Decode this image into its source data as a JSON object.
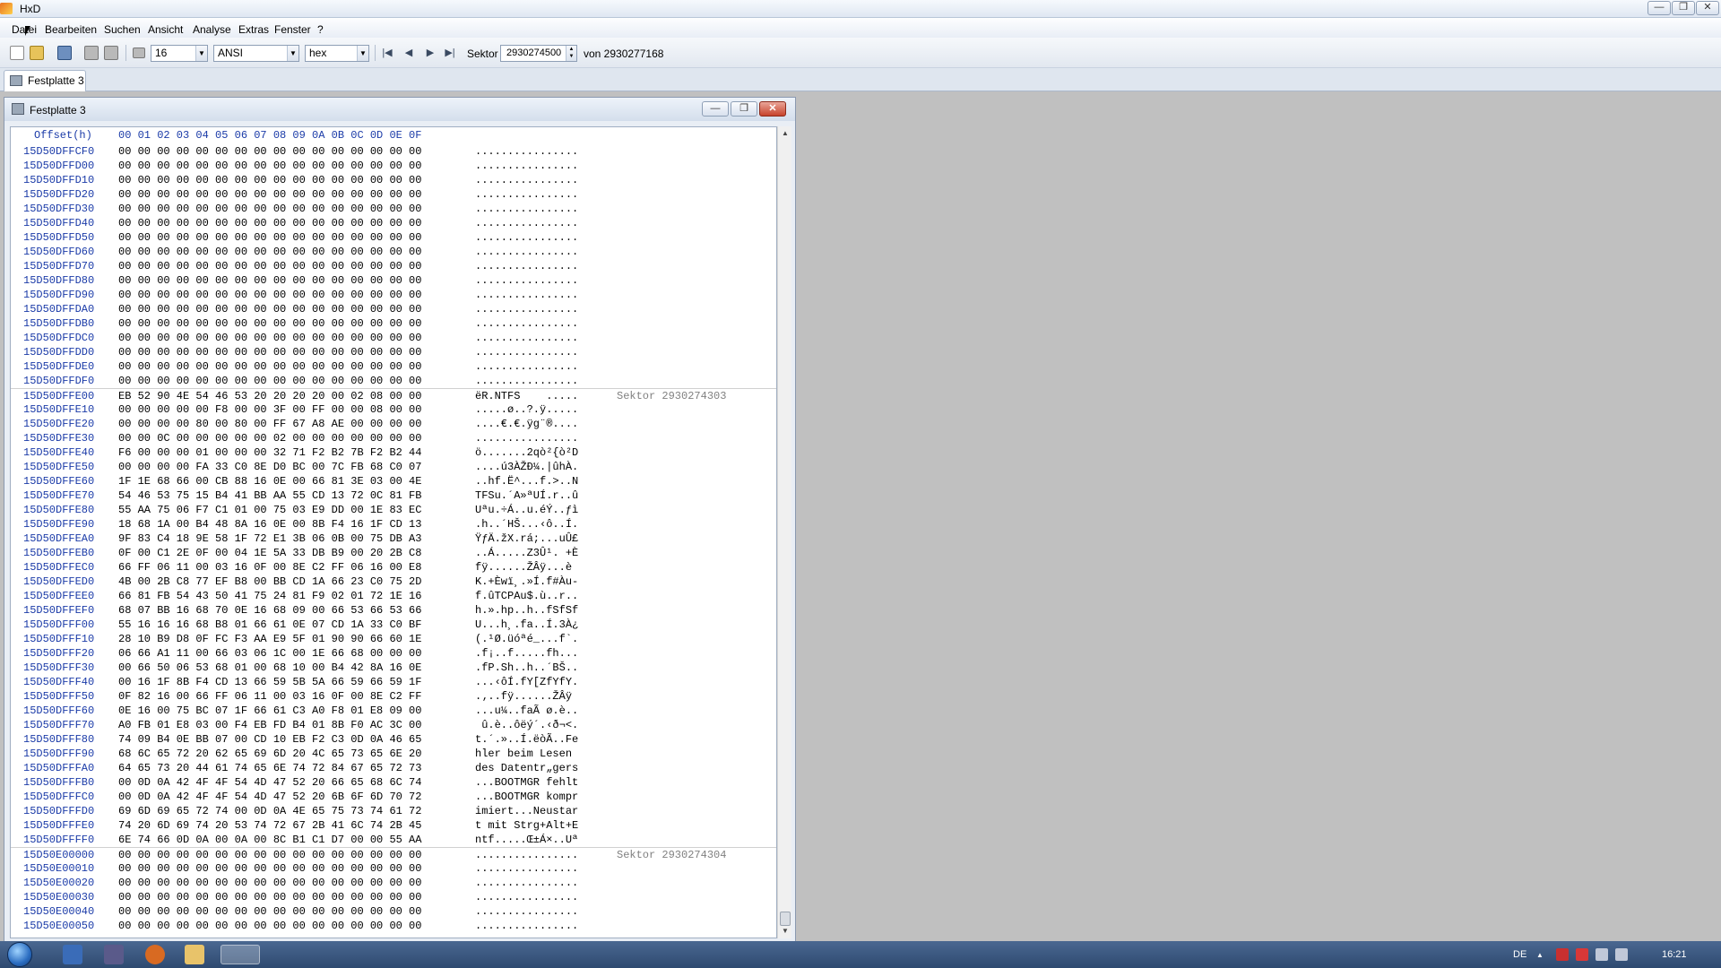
{
  "window": {
    "title": "HxD",
    "min_label": "—",
    "max_label": "❐",
    "close_label": "✕"
  },
  "menu": [
    "Datei",
    "Bearbeiten",
    "Suchen",
    "Ansicht",
    "Analyse",
    "Extras",
    "Fenster",
    "?"
  ],
  "toolbar": {
    "bytes_per_row": "16",
    "charset": "ANSI",
    "offset_base": "hex",
    "sector_label": "Sektor",
    "sector_value": "2930274500",
    "sector_total": "von 2930277168",
    "nav_first": "|◀",
    "nav_prev": "◀",
    "nav_next": "▶",
    "nav_last": "▶|",
    "combo_arrow": "▼",
    "spin_up": "▲",
    "spin_down": "▼"
  },
  "tab": {
    "label": "Festplatte 3"
  },
  "child": {
    "title": "Festplatte 3",
    "min_label": "—",
    "max_label": "❐",
    "close_label": "✕"
  },
  "hex": {
    "offset_header": "Offset(h)",
    "column_header": "00 01 02 03 04 05 06 07 08 09 0A 0B 0C 0D 0E 0F",
    "rows": [
      {
        "addr": "15D50DFFCF0",
        "hex": "00 00 00 00 00 00 00 00 00 00 00 00 00 00 00 00",
        "text": "................",
        "sec": ""
      },
      {
        "addr": "15D50DFFD00",
        "hex": "00 00 00 00 00 00 00 00 00 00 00 00 00 00 00 00",
        "text": "................",
        "sec": ""
      },
      {
        "addr": "15D50DFFD10",
        "hex": "00 00 00 00 00 00 00 00 00 00 00 00 00 00 00 00",
        "text": "................",
        "sec": ""
      },
      {
        "addr": "15D50DFFD20",
        "hex": "00 00 00 00 00 00 00 00 00 00 00 00 00 00 00 00",
        "text": "................",
        "sec": ""
      },
      {
        "addr": "15D50DFFD30",
        "hex": "00 00 00 00 00 00 00 00 00 00 00 00 00 00 00 00",
        "text": "................",
        "sec": ""
      },
      {
        "addr": "15D50DFFD40",
        "hex": "00 00 00 00 00 00 00 00 00 00 00 00 00 00 00 00",
        "text": "................",
        "sec": ""
      },
      {
        "addr": "15D50DFFD50",
        "hex": "00 00 00 00 00 00 00 00 00 00 00 00 00 00 00 00",
        "text": "................",
        "sec": ""
      },
      {
        "addr": "15D50DFFD60",
        "hex": "00 00 00 00 00 00 00 00 00 00 00 00 00 00 00 00",
        "text": "................",
        "sec": ""
      },
      {
        "addr": "15D50DFFD70",
        "hex": "00 00 00 00 00 00 00 00 00 00 00 00 00 00 00 00",
        "text": "................",
        "sec": ""
      },
      {
        "addr": "15D50DFFD80",
        "hex": "00 00 00 00 00 00 00 00 00 00 00 00 00 00 00 00",
        "text": "................",
        "sec": ""
      },
      {
        "addr": "15D50DFFD90",
        "hex": "00 00 00 00 00 00 00 00 00 00 00 00 00 00 00 00",
        "text": "................",
        "sec": ""
      },
      {
        "addr": "15D50DFFDA0",
        "hex": "00 00 00 00 00 00 00 00 00 00 00 00 00 00 00 00",
        "text": "................",
        "sec": ""
      },
      {
        "addr": "15D50DFFDB0",
        "hex": "00 00 00 00 00 00 00 00 00 00 00 00 00 00 00 00",
        "text": "................",
        "sec": ""
      },
      {
        "addr": "15D50DFFDC0",
        "hex": "00 00 00 00 00 00 00 00 00 00 00 00 00 00 00 00",
        "text": "................",
        "sec": ""
      },
      {
        "addr": "15D50DFFDD0",
        "hex": "00 00 00 00 00 00 00 00 00 00 00 00 00 00 00 00",
        "text": "................",
        "sec": ""
      },
      {
        "addr": "15D50DFFDE0",
        "hex": "00 00 00 00 00 00 00 00 00 00 00 00 00 00 00 00",
        "text": "................",
        "sec": ""
      },
      {
        "addr": "15D50DFFDF0",
        "hex": "00 00 00 00 00 00 00 00 00 00 00 00 00 00 00 00",
        "text": "................",
        "sec": ""
      },
      {
        "addr": "15D50DFFE00",
        "hex": "EB 52 90 4E 54 46 53 20 20 20 20 00 02 08 00 00",
        "text": "ëR.NTFS    .....",
        "sec": "Sektor 2930274303"
      },
      {
        "addr": "15D50DFFE10",
        "hex": "00 00 00 00 00 F8 00 00 3F 00 FF 00 00 08 00 00",
        "text": ".....ø..?.ÿ.....",
        "sec": ""
      },
      {
        "addr": "15D50DFFE20",
        "hex": "00 00 00 00 80 00 80 00 FF 67 A8 AE 00 00 00 00",
        "text": "....€.€.ÿg¨®....",
        "sec": ""
      },
      {
        "addr": "15D50DFFE30",
        "hex": "00 00 0C 00 00 00 00 00 02 00 00 00 00 00 00 00",
        "text": "................",
        "sec": ""
      },
      {
        "addr": "15D50DFFE40",
        "hex": "F6 00 00 00 01 00 00 00 32 71 F2 B2 7B F2 B2 44",
        "text": "ö.......2qò²{ò²D",
        "sec": ""
      },
      {
        "addr": "15D50DFFE50",
        "hex": "00 00 00 00 FA 33 C0 8E D0 BC 00 7C FB 68 C0 07",
        "text": "....ú3ÀŽÐ¼.|ûhÀ.",
        "sec": ""
      },
      {
        "addr": "15D50DFFE60",
        "hex": "1F 1E 68 66 00 CB 88 16 0E 00 66 81 3E 03 00 4E",
        "text": "..hf.Ë^...f.>..N",
        "sec": ""
      },
      {
        "addr": "15D50DFFE70",
        "hex": "54 46 53 75 15 B4 41 BB AA 55 CD 13 72 0C 81 FB",
        "text": "TFSu.´A»ªUÍ.r..û",
        "sec": ""
      },
      {
        "addr": "15D50DFFE80",
        "hex": "55 AA 75 06 F7 C1 01 00 75 03 E9 DD 00 1E 83 EC",
        "text": "Uªu.÷Á..u.éÝ..ƒì",
        "sec": ""
      },
      {
        "addr": "15D50DFFE90",
        "hex": "18 68 1A 00 B4 48 8A 16 0E 00 8B F4 16 1F CD 13",
        "text": ".h..´HŠ...‹ô..Í.",
        "sec": ""
      },
      {
        "addr": "15D50DFFEA0",
        "hex": "9F 83 C4 18 9E 58 1F 72 E1 3B 06 0B 00 75 DB A3",
        "text": "ŸƒÄ.žX.rá;...uÛ£",
        "sec": ""
      },
      {
        "addr": "15D50DFFEB0",
        "hex": "0F 00 C1 2E 0F 00 04 1E 5A 33 DB B9 00 20 2B C8",
        "text": "..Á.....Z3Û¹. +È",
        "sec": ""
      },
      {
        "addr": "15D50DFFEC0",
        "hex": "66 FF 06 11 00 03 16 0F 00 8E C2 FF 06 16 00 E8",
        "text": "fÿ......ŽÂÿ...è",
        "sec": ""
      },
      {
        "addr": "15D50DFFED0",
        "hex": "4B 00 2B C8 77 EF B8 00 BB CD 1A 66 23 C0 75 2D",
        "text": "K.+Èwï¸.»Í.f#Àu-",
        "sec": ""
      },
      {
        "addr": "15D50DFFEE0",
        "hex": "66 81 FB 54 43 50 41 75 24 81 F9 02 01 72 1E 16",
        "text": "f.ûTCPAu$.ù..r..",
        "sec": ""
      },
      {
        "addr": "15D50DFFEF0",
        "hex": "68 07 BB 16 68 70 0E 16 68 09 00 66 53 66 53 66",
        "text": "h.».hp..h..fSfSf",
        "sec": ""
      },
      {
        "addr": "15D50DFFF00",
        "hex": "55 16 16 16 68 B8 01 66 61 0E 07 CD 1A 33 C0 BF",
        "text": "U...h¸.fa..Í.3À¿",
        "sec": ""
      },
      {
        "addr": "15D50DFFF10",
        "hex": "28 10 B9 D8 0F FC F3 AA E9 5F 01 90 90 66 60 1E",
        "text": "(.¹Ø.üóªé_...f`.",
        "sec": ""
      },
      {
        "addr": "15D50DFFF20",
        "hex": "06 66 A1 11 00 66 03 06 1C 00 1E 66 68 00 00 00",
        "text": ".f¡..f.....fh...",
        "sec": ""
      },
      {
        "addr": "15D50DFFF30",
        "hex": "00 66 50 06 53 68 01 00 68 10 00 B4 42 8A 16 0E",
        "text": ".fP.Sh..h..´BŠ..",
        "sec": ""
      },
      {
        "addr": "15D50DFFF40",
        "hex": "00 16 1F 8B F4 CD 13 66 59 5B 5A 66 59 66 59 1F",
        "text": "...‹ôÍ.fY[ZfYfY.",
        "sec": ""
      },
      {
        "addr": "15D50DFFF50",
        "hex": "0F 82 16 00 66 FF 06 11 00 03 16 0F 00 8E C2 FF",
        "text": ".‚..fÿ......ŽÂÿ",
        "sec": ""
      },
      {
        "addr": "15D50DFFF60",
        "hex": "0E 16 00 75 BC 07 1F 66 61 C3 A0 F8 01 E8 09 00",
        "text": "...u¼..faÃ ø.è..",
        "sec": ""
      },
      {
        "addr": "15D50DFFF70",
        "hex": "A0 FB 01 E8 03 00 F4 EB FD B4 01 8B F0 AC 3C 00",
        "text": " û.è..ôëý´.‹ð¬<.",
        "sec": ""
      },
      {
        "addr": "15D50DFFF80",
        "hex": "74 09 B4 0E BB 07 00 CD 10 EB F2 C3 0D 0A 46 65",
        "text": "t.´.»..Í.ëòÃ..Fe",
        "sec": ""
      },
      {
        "addr": "15D50DFFF90",
        "hex": "68 6C 65 72 20 62 65 69 6D 20 4C 65 73 65 6E 20",
        "text": "hler beim Lesen ",
        "sec": ""
      },
      {
        "addr": "15D50DFFFA0",
        "hex": "64 65 73 20 44 61 74 65 6E 74 72 84 67 65 72 73",
        "text": "des Datentr„gers",
        "sec": ""
      },
      {
        "addr": "15D50DFFFB0",
        "hex": "00 0D 0A 42 4F 4F 54 4D 47 52 20 66 65 68 6C 74",
        "text": "...BOOTMGR fehlt",
        "sec": ""
      },
      {
        "addr": "15D50DFFFC0",
        "hex": "00 0D 0A 42 4F 4F 54 4D 47 52 20 6B 6F 6D 70 72",
        "text": "...BOOTMGR kompr",
        "sec": ""
      },
      {
        "addr": "15D50DFFFD0",
        "hex": "69 6D 69 65 72 74 00 0D 0A 4E 65 75 73 74 61 72",
        "text": "imiert...Neustar",
        "sec": ""
      },
      {
        "addr": "15D50DFFFE0",
        "hex": "74 20 6D 69 74 20 53 74 72 67 2B 41 6C 74 2B 45",
        "text": "t mit Strg+Alt+E",
        "sec": ""
      },
      {
        "addr": "15D50DFFFF0",
        "hex": "6E 74 66 0D 0A 00 0A 00 8C B1 C1 D7 00 00 55 AA",
        "text": "ntf.....Œ±Á×..Uª",
        "sec": ""
      },
      {
        "addr": "15D50E00000",
        "hex": "00 00 00 00 00 00 00 00 00 00 00 00 00 00 00 00",
        "text": "................",
        "sec": "Sektor 2930274304"
      },
      {
        "addr": "15D50E00010",
        "hex": "00 00 00 00 00 00 00 00 00 00 00 00 00 00 00 00",
        "text": "................",
        "sec": ""
      },
      {
        "addr": "15D50E00020",
        "hex": "00 00 00 00 00 00 00 00 00 00 00 00 00 00 00 00",
        "text": "................",
        "sec": ""
      },
      {
        "addr": "15D50E00030",
        "hex": "00 00 00 00 00 00 00 00 00 00 00 00 00 00 00 00",
        "text": "................",
        "sec": ""
      },
      {
        "addr": "15D50E00040",
        "hex": "00 00 00 00 00 00 00 00 00 00 00 00 00 00 00 00",
        "text": "................",
        "sec": ""
      },
      {
        "addr": "15D50E00050",
        "hex": "00 00 00 00 00 00 00 00 00 00 00 00 00 00 00 00",
        "text": "................",
        "sec": ""
      }
    ]
  },
  "scrollbar": {
    "up_label": "▲",
    "down_label": "▼"
  },
  "taskbar": {
    "lang": "DE",
    "time": "16:21",
    "tray_arrow": "▲"
  },
  "colors": {
    "offset_blue": "#1b3ba8",
    "sector_gray": "#808080",
    "mdi_bg": "#c0c0c0"
  }
}
